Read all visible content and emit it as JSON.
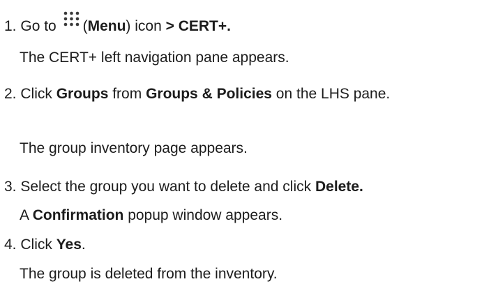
{
  "steps": [
    {
      "number": "1.",
      "parts": {
        "a": "Go to",
        "b": "(",
        "menu": "Menu",
        "c": ") icon",
        "d": "> CERT+."
      },
      "icon": "menu-grid-icon",
      "result": "The CERT+ left navigation pane appears."
    },
    {
      "number": "2.",
      "parts": {
        "a": "Click",
        "groups": "Groups",
        "b": "from",
        "groups_policies": "Groups & Policies",
        "c": "on the LHS pane."
      },
      "result": "The group inventory page appears."
    },
    {
      "number": "3.",
      "parts": {
        "a": "Select the group you want to delete and click",
        "delete": "Delete."
      },
      "result_parts": {
        "a": "A",
        "confirmation": "Confirmation",
        "b": "popup window appears."
      }
    },
    {
      "number": "4.",
      "parts": {
        "a": "Click",
        "yes": "Yes",
        "b": "."
      },
      "result": "The group is deleted from the inventory."
    }
  ]
}
